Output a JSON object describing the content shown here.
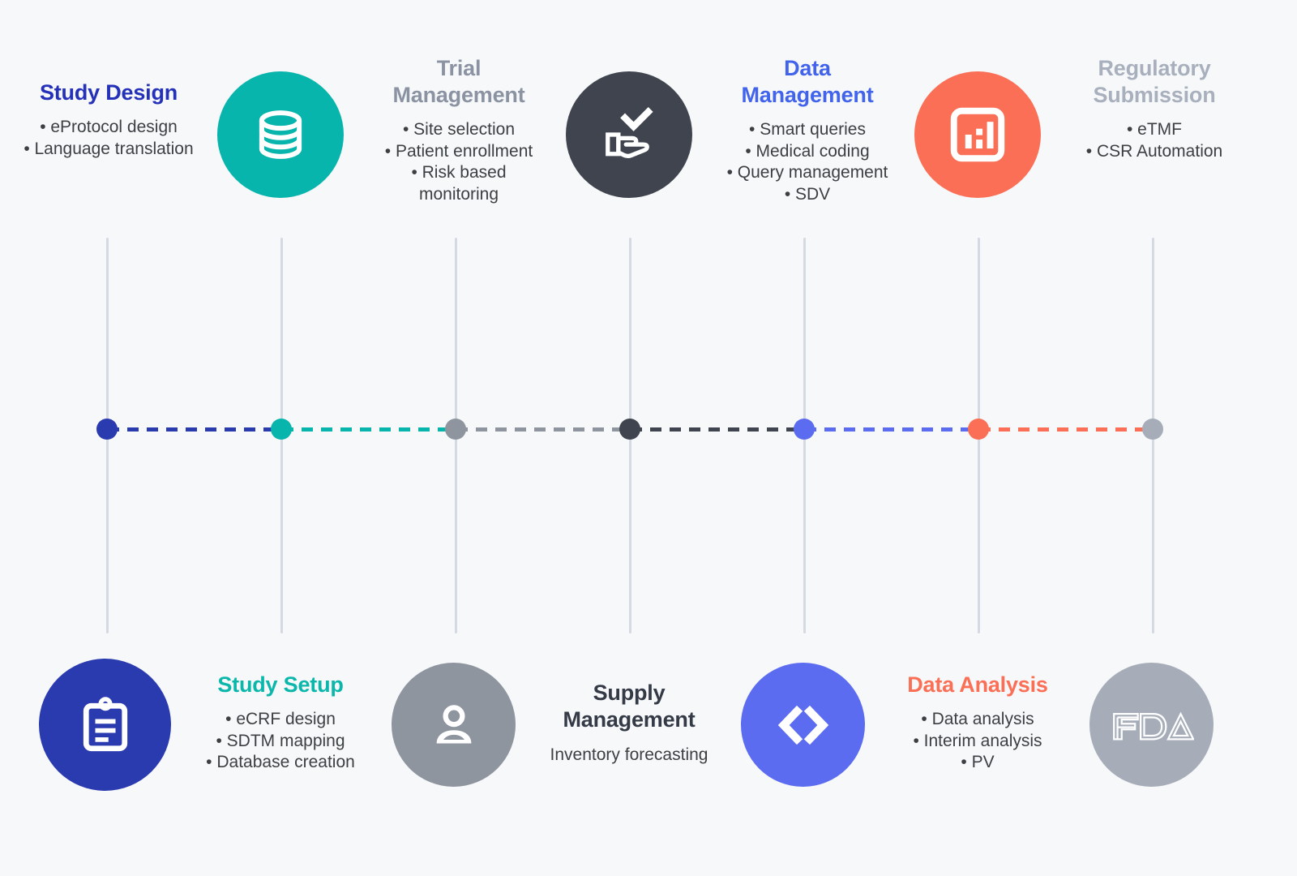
{
  "diagram": {
    "title_visible": false,
    "background_color": "#f7f8fa",
    "rule_color": "#d5d9e2"
  },
  "top_row": [
    {
      "id": "study-design",
      "title": "Study Design",
      "title_color": "#2431b8",
      "bullets": [
        "eProtocol design",
        "Language translation"
      ]
    },
    {
      "id": "trial-management",
      "title": "Trial Management",
      "title_color": "#8b93a3",
      "bullets": [
        "Site selection",
        "Patient enrollment",
        "Risk based monitoring"
      ]
    },
    {
      "id": "data-management",
      "title": "Data Management",
      "title_color": "#4263eb",
      "bullets": [
        "Smart queries",
        "Medical coding",
        "Query management",
        "SDV"
      ]
    },
    {
      "id": "regulatory-submission",
      "title": "Regulatory Submission",
      "title_color": "#a9b0bd",
      "bullets": [
        "eTMF",
        "CSR Automation"
      ]
    }
  ],
  "bottom_row": [
    {
      "id": "study-setup",
      "title": "Study Setup",
      "title_color": "#0bb7ab",
      "bullets": [
        "eCRF design",
        "SDTM mapping",
        "Database creation"
      ]
    },
    {
      "id": "supply-management",
      "title": "Supply Management",
      "title_color": "#343a46",
      "bullets": [],
      "plain_text": "Inventory forecasting"
    },
    {
      "id": "data-analysis",
      "title": "Data Analysis",
      "title_color": "#fa6f55",
      "bullets": [
        "Data analysis",
        "Interim analysis",
        "PV"
      ]
    }
  ],
  "icon_circles": [
    {
      "id": "clipboard-circle",
      "icon": "clipboard-icon",
      "color": "#2a3bb0",
      "row": "bottom"
    },
    {
      "id": "database-circle",
      "icon": "database-icon",
      "color": "#07b5ac",
      "row": "top"
    },
    {
      "id": "person-circle",
      "icon": "person-icon",
      "color": "#8f959f",
      "row": "bottom"
    },
    {
      "id": "hand-check-circle",
      "icon": "hand-check-icon",
      "color": "#3f444e",
      "row": "top"
    },
    {
      "id": "code-circle",
      "icon": "code-brackets-icon",
      "color": "#5b6cf0",
      "row": "bottom"
    },
    {
      "id": "barchart-circle",
      "icon": "bar-chart-icon",
      "color": "#fa6f55",
      "row": "top"
    },
    {
      "id": "fda-circle",
      "icon": "fda-logo-icon",
      "color": "#a6adb9",
      "row": "bottom"
    }
  ],
  "timeline": {
    "dots": [
      {
        "id": "dot-1",
        "color": "#2a3bb0"
      },
      {
        "id": "dot-2",
        "color": "#07b5ac"
      },
      {
        "id": "dot-3",
        "color": "#8f959f"
      },
      {
        "id": "dot-4",
        "color": "#3f444e"
      },
      {
        "id": "dot-5",
        "color": "#5b6cf0"
      },
      {
        "id": "dot-6",
        "color": "#fa6f55"
      },
      {
        "id": "dot-7",
        "color": "#a6adb9"
      }
    ],
    "segments": [
      {
        "id": "seg-1",
        "color": "#2a3bb0"
      },
      {
        "id": "seg-2",
        "color": "#07b5ac"
      },
      {
        "id": "seg-3",
        "color": "#8f959f"
      },
      {
        "id": "seg-4",
        "color": "#3f444e"
      },
      {
        "id": "seg-5",
        "color": "#5b6cf0"
      },
      {
        "id": "seg-6",
        "color": "#fa6f55"
      }
    ]
  }
}
